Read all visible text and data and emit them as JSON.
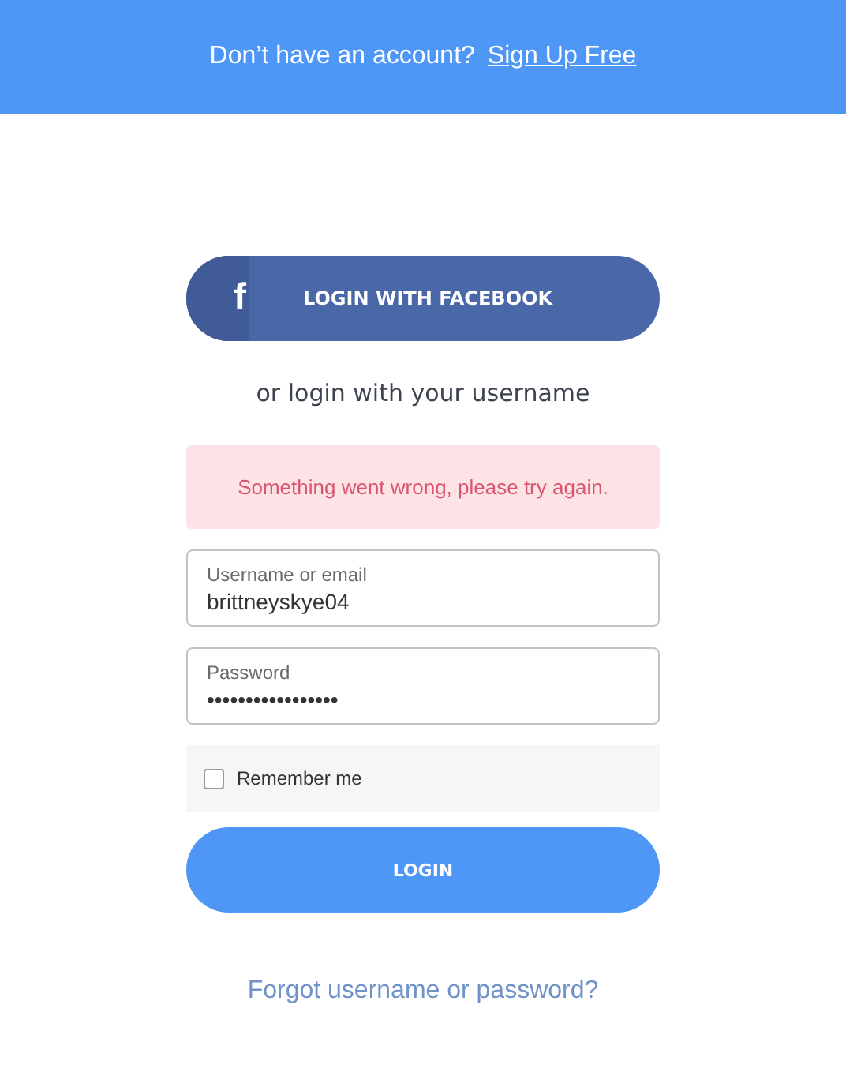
{
  "banner": {
    "text": "Don’t have an account?",
    "link": "Sign Up Free"
  },
  "facebook_button": {
    "icon": "f",
    "label": "LOGIN WITH FACEBOOK"
  },
  "subtitle": "or login with your username",
  "error": "Something went wrong, please try again.",
  "fields": [
    {
      "label": "Username or email",
      "value": "brittneyskye04"
    },
    {
      "label": "Password",
      "value": "•••••••••••••••••"
    }
  ],
  "remember": {
    "label": "Remember me",
    "checked": false
  },
  "login_button": "LOGIN",
  "forgot_link": "Forgot username or password?"
}
